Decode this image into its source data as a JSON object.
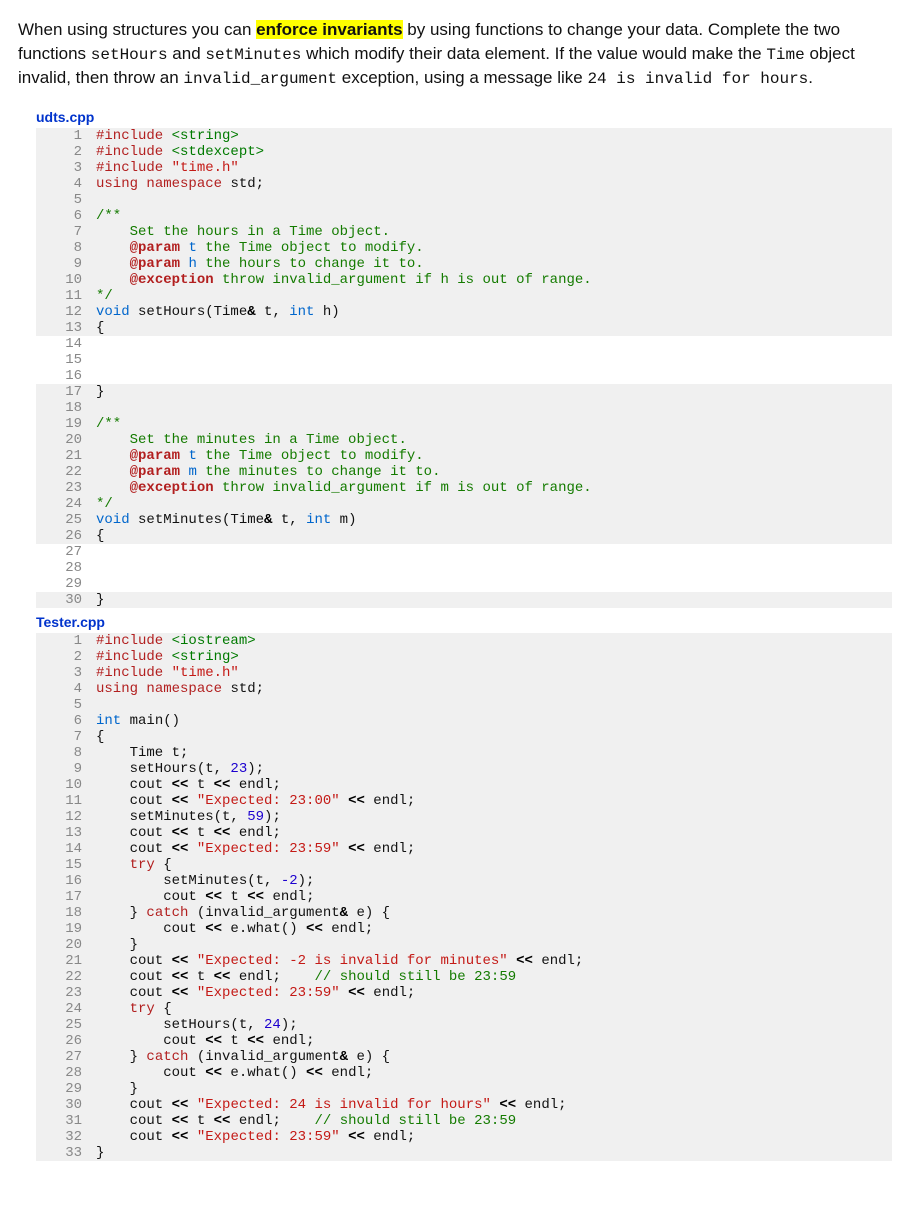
{
  "intro": {
    "t1": "When using structures you can ",
    "hl": "enforce invariants",
    "t2": " by using functions to change your data. Complete the two functions ",
    "c1": "setHours",
    "t3": " and ",
    "c2": "setMinutes",
    "t4": " which modify their data element. If the value would make the ",
    "c3": "Time",
    "t5": " object invalid, then throw an ",
    "c4": "invalid_argument",
    "t6": " exception, using a message like ",
    "c5": "24 is invalid for hours",
    "t7": "."
  },
  "file1": {
    "name": "udts.cpp",
    "lines": [
      {
        "n": 1,
        "shade": "gray",
        "tokens": [
          [
            "pp",
            "#include "
          ],
          [
            "ang",
            "<string>"
          ]
        ]
      },
      {
        "n": 2,
        "shade": "gray",
        "tokens": [
          [
            "pp",
            "#include "
          ],
          [
            "ang",
            "<stdexcept>"
          ]
        ]
      },
      {
        "n": 3,
        "shade": "gray",
        "tokens": [
          [
            "pp",
            "#include "
          ],
          [
            "str",
            "\"time.h\""
          ]
        ]
      },
      {
        "n": 4,
        "shade": "gray",
        "tokens": [
          [
            "kw",
            "using "
          ],
          [
            "kw",
            "namespace "
          ],
          [
            "",
            "std;"
          ]
        ]
      },
      {
        "n": 5,
        "shade": "gray",
        "tokens": [
          [
            "",
            ""
          ]
        ]
      },
      {
        "n": 6,
        "shade": "gray",
        "tokens": [
          [
            "com",
            "/**"
          ]
        ]
      },
      {
        "n": 7,
        "shade": "gray",
        "tokens": [
          [
            "com",
            "    Set the hours in a Time object."
          ]
        ]
      },
      {
        "n": 8,
        "shade": "gray",
        "tokens": [
          [
            "com",
            "    "
          ],
          [
            "tag",
            "@param"
          ],
          [
            "com",
            " "
          ],
          [
            "p1",
            "t"
          ],
          [
            "com",
            " the Time object to modify."
          ]
        ]
      },
      {
        "n": 9,
        "shade": "gray",
        "tokens": [
          [
            "com",
            "    "
          ],
          [
            "tag",
            "@param"
          ],
          [
            "com",
            " "
          ],
          [
            "p1",
            "h"
          ],
          [
            "com",
            " the hours to change it to."
          ]
        ]
      },
      {
        "n": 10,
        "shade": "gray",
        "tokens": [
          [
            "com",
            "    "
          ],
          [
            "tag",
            "@exception"
          ],
          [
            "com",
            " throw invalid_argument if h is out of range."
          ]
        ]
      },
      {
        "n": 11,
        "shade": "gray",
        "tokens": [
          [
            "com",
            "*/"
          ]
        ]
      },
      {
        "n": 12,
        "shade": "gray",
        "tokens": [
          [
            "type",
            "void "
          ],
          [
            "",
            "setHours(Time"
          ],
          [
            "op",
            "&"
          ],
          [
            "",
            " t, "
          ],
          [
            "type",
            "int"
          ],
          [
            "",
            " h)"
          ]
        ]
      },
      {
        "n": 13,
        "shade": "gray",
        "tokens": [
          [
            "",
            "{"
          ]
        ]
      },
      {
        "n": 14,
        "shade": "white",
        "tokens": [
          [
            "",
            ""
          ]
        ]
      },
      {
        "n": 15,
        "shade": "white",
        "tokens": [
          [
            "",
            ""
          ]
        ]
      },
      {
        "n": 16,
        "shade": "white",
        "tokens": [
          [
            "",
            ""
          ]
        ]
      },
      {
        "n": 17,
        "shade": "gray",
        "tokens": [
          [
            "",
            "}"
          ]
        ]
      },
      {
        "n": 18,
        "shade": "gray",
        "tokens": [
          [
            "",
            ""
          ]
        ]
      },
      {
        "n": 19,
        "shade": "gray",
        "tokens": [
          [
            "com",
            "/**"
          ]
        ]
      },
      {
        "n": 20,
        "shade": "gray",
        "tokens": [
          [
            "com",
            "    Set the minutes in a Time object."
          ]
        ]
      },
      {
        "n": 21,
        "shade": "gray",
        "tokens": [
          [
            "com",
            "    "
          ],
          [
            "tag",
            "@param"
          ],
          [
            "com",
            " "
          ],
          [
            "p1",
            "t"
          ],
          [
            "com",
            " the Time object to modify."
          ]
        ]
      },
      {
        "n": 22,
        "shade": "gray",
        "tokens": [
          [
            "com",
            "    "
          ],
          [
            "tag",
            "@param"
          ],
          [
            "com",
            " "
          ],
          [
            "p1",
            "m"
          ],
          [
            "com",
            " the minutes to change it to."
          ]
        ]
      },
      {
        "n": 23,
        "shade": "gray",
        "tokens": [
          [
            "com",
            "    "
          ],
          [
            "tag",
            "@exception"
          ],
          [
            "com",
            " throw invalid_argument if m is out of range."
          ]
        ]
      },
      {
        "n": 24,
        "shade": "gray",
        "tokens": [
          [
            "com",
            "*/"
          ]
        ]
      },
      {
        "n": 25,
        "shade": "gray",
        "tokens": [
          [
            "type",
            "void "
          ],
          [
            "",
            "setMinutes(Time"
          ],
          [
            "op",
            "&"
          ],
          [
            "",
            " t, "
          ],
          [
            "type",
            "int"
          ],
          [
            "",
            " m)"
          ]
        ]
      },
      {
        "n": 26,
        "shade": "gray",
        "tokens": [
          [
            "",
            "{"
          ]
        ]
      },
      {
        "n": 27,
        "shade": "white",
        "tokens": [
          [
            "",
            ""
          ]
        ]
      },
      {
        "n": 28,
        "shade": "white",
        "tokens": [
          [
            "",
            ""
          ]
        ]
      },
      {
        "n": 29,
        "shade": "white",
        "tokens": [
          [
            "",
            ""
          ]
        ]
      },
      {
        "n": 30,
        "shade": "gray",
        "tokens": [
          [
            "",
            "}"
          ]
        ]
      }
    ]
  },
  "file2": {
    "name": "Tester.cpp",
    "lines": [
      {
        "n": 1,
        "shade": "gray",
        "tokens": [
          [
            "pp",
            "#include "
          ],
          [
            "ang",
            "<iostream>"
          ]
        ]
      },
      {
        "n": 2,
        "shade": "gray",
        "tokens": [
          [
            "pp",
            "#include "
          ],
          [
            "ang",
            "<string>"
          ]
        ]
      },
      {
        "n": 3,
        "shade": "gray",
        "tokens": [
          [
            "pp",
            "#include "
          ],
          [
            "str",
            "\"time.h\""
          ]
        ]
      },
      {
        "n": 4,
        "shade": "gray",
        "tokens": [
          [
            "kw",
            "using "
          ],
          [
            "kw",
            "namespace "
          ],
          [
            "",
            "std;"
          ]
        ]
      },
      {
        "n": 5,
        "shade": "gray",
        "tokens": [
          [
            "",
            ""
          ]
        ]
      },
      {
        "n": 6,
        "shade": "gray",
        "tokens": [
          [
            "type",
            "int "
          ],
          [
            "",
            "main()"
          ]
        ]
      },
      {
        "n": 7,
        "shade": "gray",
        "tokens": [
          [
            "",
            "{"
          ]
        ]
      },
      {
        "n": 8,
        "shade": "gray",
        "tokens": [
          [
            "",
            "    Time t;"
          ]
        ]
      },
      {
        "n": 9,
        "shade": "gray",
        "tokens": [
          [
            "",
            "    setHours(t, "
          ],
          [
            "num",
            "23"
          ],
          [
            "",
            ");"
          ]
        ]
      },
      {
        "n": 10,
        "shade": "gray",
        "tokens": [
          [
            "",
            "    cout "
          ],
          [
            "op",
            "<<"
          ],
          [
            "",
            " t "
          ],
          [
            "op",
            "<<"
          ],
          [
            "",
            " endl;"
          ]
        ]
      },
      {
        "n": 11,
        "shade": "gray",
        "tokens": [
          [
            "",
            "    cout "
          ],
          [
            "op",
            "<<"
          ],
          [
            "",
            " "
          ],
          [
            "str",
            "\"Expected: 23:00\""
          ],
          [
            "",
            " "
          ],
          [
            "op",
            "<<"
          ],
          [
            "",
            " endl;"
          ]
        ]
      },
      {
        "n": 12,
        "shade": "gray",
        "tokens": [
          [
            "",
            "    setMinutes(t, "
          ],
          [
            "num",
            "59"
          ],
          [
            "",
            ");"
          ]
        ]
      },
      {
        "n": 13,
        "shade": "gray",
        "tokens": [
          [
            "",
            "    cout "
          ],
          [
            "op",
            "<<"
          ],
          [
            "",
            " t "
          ],
          [
            "op",
            "<<"
          ],
          [
            "",
            " endl;"
          ]
        ]
      },
      {
        "n": 14,
        "shade": "gray",
        "tokens": [
          [
            "",
            "    cout "
          ],
          [
            "op",
            "<<"
          ],
          [
            "",
            " "
          ],
          [
            "str",
            "\"Expected: 23:59\""
          ],
          [
            "",
            " "
          ],
          [
            "op",
            "<<"
          ],
          [
            "",
            " endl;"
          ]
        ]
      },
      {
        "n": 15,
        "shade": "gray",
        "tokens": [
          [
            "",
            "    "
          ],
          [
            "kw",
            "try"
          ],
          [
            "",
            " {"
          ]
        ]
      },
      {
        "n": 16,
        "shade": "gray",
        "tokens": [
          [
            "",
            "        setMinutes(t, "
          ],
          [
            "num",
            "-2"
          ],
          [
            "",
            ");"
          ]
        ]
      },
      {
        "n": 17,
        "shade": "gray",
        "tokens": [
          [
            "",
            "        cout "
          ],
          [
            "op",
            "<<"
          ],
          [
            "",
            " t "
          ],
          [
            "op",
            "<<"
          ],
          [
            "",
            " endl;"
          ]
        ]
      },
      {
        "n": 18,
        "shade": "gray",
        "tokens": [
          [
            "",
            "    } "
          ],
          [
            "kw",
            "catch"
          ],
          [
            "",
            " (invalid_argument"
          ],
          [
            "op",
            "&"
          ],
          [
            "",
            " e) {"
          ]
        ]
      },
      {
        "n": 19,
        "shade": "gray",
        "tokens": [
          [
            "",
            "        cout "
          ],
          [
            "op",
            "<<"
          ],
          [
            "",
            " e.what() "
          ],
          [
            "op",
            "<<"
          ],
          [
            "",
            " endl;"
          ]
        ]
      },
      {
        "n": 20,
        "shade": "gray",
        "tokens": [
          [
            "",
            "    }"
          ]
        ]
      },
      {
        "n": 21,
        "shade": "gray",
        "tokens": [
          [
            "",
            "    cout "
          ],
          [
            "op",
            "<<"
          ],
          [
            "",
            " "
          ],
          [
            "str",
            "\"Expected: -2 is invalid for minutes\""
          ],
          [
            "",
            " "
          ],
          [
            "op",
            "<<"
          ],
          [
            "",
            " endl;"
          ]
        ]
      },
      {
        "n": 22,
        "shade": "gray",
        "tokens": [
          [
            "",
            "    cout "
          ],
          [
            "op",
            "<<"
          ],
          [
            "",
            " t "
          ],
          [
            "op",
            "<<"
          ],
          [
            "",
            " endl;    "
          ],
          [
            "linecom",
            "// should still be 23:59"
          ]
        ]
      },
      {
        "n": 23,
        "shade": "gray",
        "tokens": [
          [
            "",
            "    cout "
          ],
          [
            "op",
            "<<"
          ],
          [
            "",
            " "
          ],
          [
            "str",
            "\"Expected: 23:59\""
          ],
          [
            "",
            " "
          ],
          [
            "op",
            "<<"
          ],
          [
            "",
            " endl;"
          ]
        ]
      },
      {
        "n": 24,
        "shade": "gray",
        "tokens": [
          [
            "",
            "    "
          ],
          [
            "kw",
            "try"
          ],
          [
            "",
            " {"
          ]
        ]
      },
      {
        "n": 25,
        "shade": "gray",
        "tokens": [
          [
            "",
            "        setHours(t, "
          ],
          [
            "num",
            "24"
          ],
          [
            "",
            ");"
          ]
        ]
      },
      {
        "n": 26,
        "shade": "gray",
        "tokens": [
          [
            "",
            "        cout "
          ],
          [
            "op",
            "<<"
          ],
          [
            "",
            " t "
          ],
          [
            "op",
            "<<"
          ],
          [
            "",
            " endl;"
          ]
        ]
      },
      {
        "n": 27,
        "shade": "gray",
        "tokens": [
          [
            "",
            "    } "
          ],
          [
            "kw",
            "catch"
          ],
          [
            "",
            " (invalid_argument"
          ],
          [
            "op",
            "&"
          ],
          [
            "",
            " e) {"
          ]
        ]
      },
      {
        "n": 28,
        "shade": "gray",
        "tokens": [
          [
            "",
            "        cout "
          ],
          [
            "op",
            "<<"
          ],
          [
            "",
            " e.what() "
          ],
          [
            "op",
            "<<"
          ],
          [
            "",
            " endl;"
          ]
        ]
      },
      {
        "n": 29,
        "shade": "gray",
        "tokens": [
          [
            "",
            "    }"
          ]
        ]
      },
      {
        "n": 30,
        "shade": "gray",
        "tokens": [
          [
            "",
            "    cout "
          ],
          [
            "op",
            "<<"
          ],
          [
            "",
            " "
          ],
          [
            "str",
            "\"Expected: 24 is invalid for hours\""
          ],
          [
            "",
            " "
          ],
          [
            "op",
            "<<"
          ],
          [
            "",
            " endl;"
          ]
        ]
      },
      {
        "n": 31,
        "shade": "gray",
        "tokens": [
          [
            "",
            "    cout "
          ],
          [
            "op",
            "<<"
          ],
          [
            "",
            " t "
          ],
          [
            "op",
            "<<"
          ],
          [
            "",
            " endl;    "
          ],
          [
            "linecom",
            "// should still be 23:59"
          ]
        ]
      },
      {
        "n": 32,
        "shade": "gray",
        "tokens": [
          [
            "",
            "    cout "
          ],
          [
            "op",
            "<<"
          ],
          [
            "",
            " "
          ],
          [
            "str",
            "\"Expected: 23:59\""
          ],
          [
            "",
            " "
          ],
          [
            "op",
            "<<"
          ],
          [
            "",
            " endl;"
          ]
        ]
      },
      {
        "n": 33,
        "shade": "gray",
        "tokens": [
          [
            "",
            "}"
          ]
        ]
      }
    ]
  }
}
